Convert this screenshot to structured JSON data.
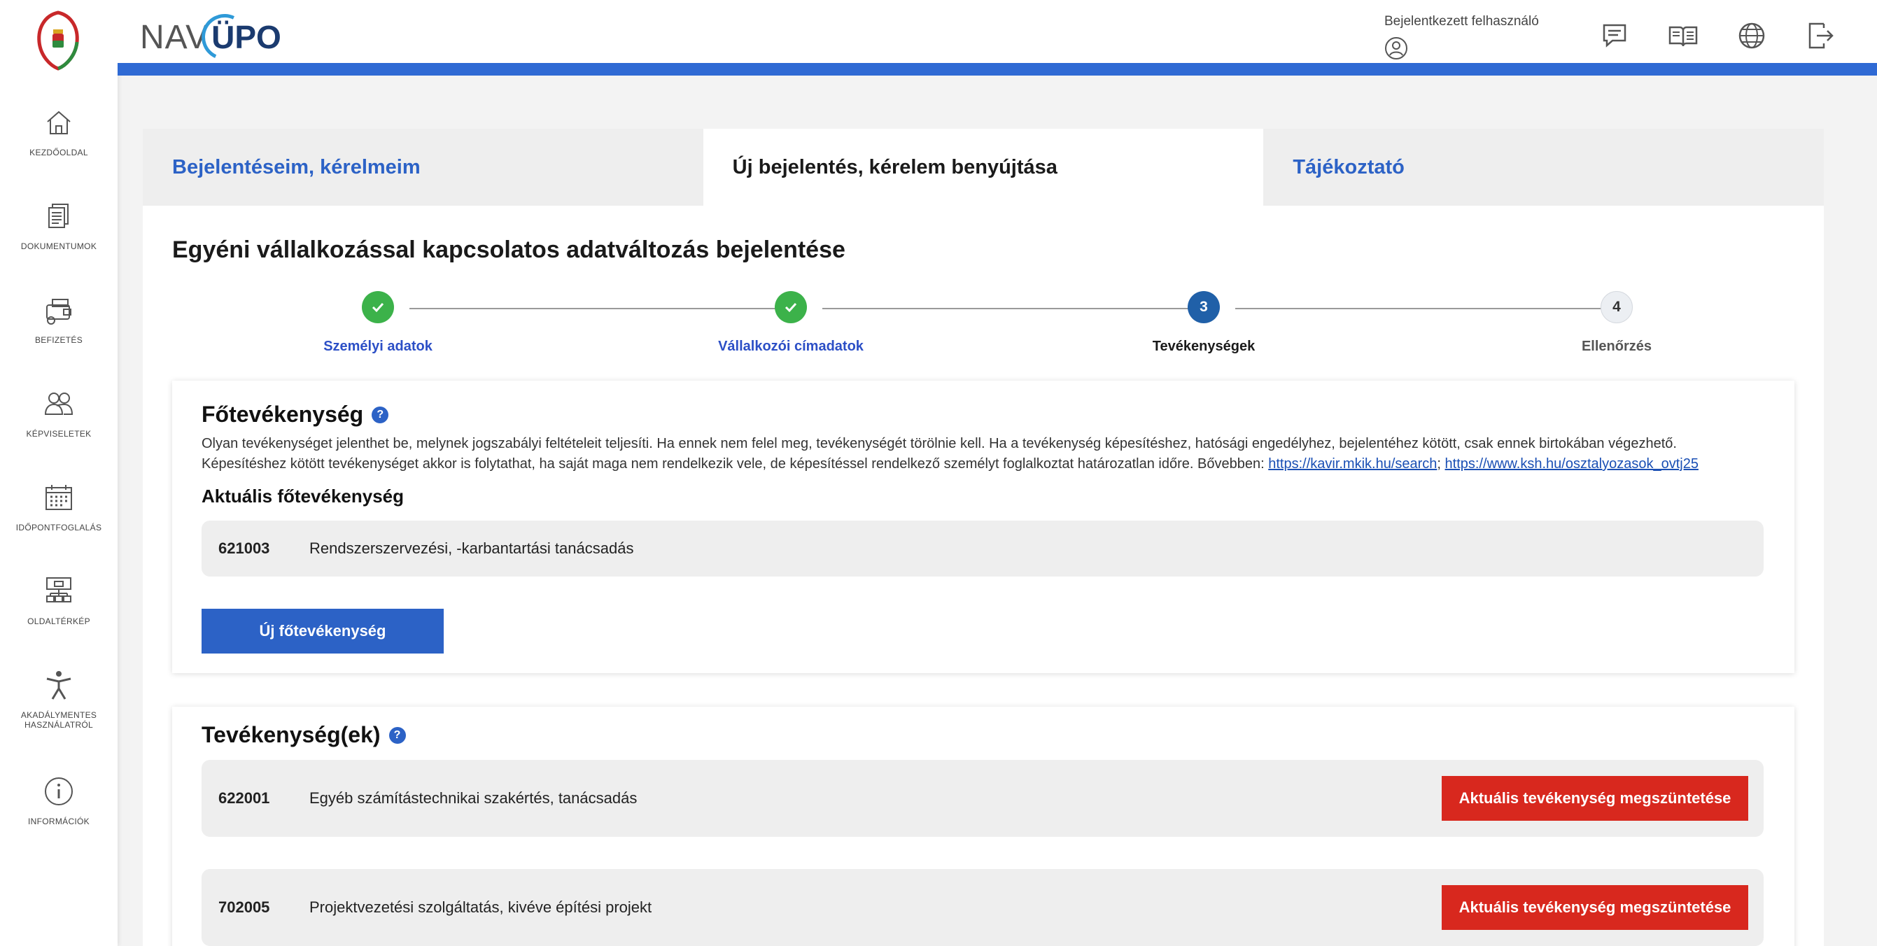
{
  "sidebar": {
    "items": [
      {
        "label": "KEZDŐOLDAL",
        "icon": "home-icon"
      },
      {
        "label": "DOKUMENTUMOK",
        "icon": "documents-icon"
      },
      {
        "label": "BEFIZETÉS",
        "icon": "wallet-icon"
      },
      {
        "label": "KÉPVISELETEK",
        "icon": "people-icon"
      },
      {
        "label": "IDŐPONTFOGLALÁS",
        "icon": "calendar-icon"
      },
      {
        "label": "OLDALTÉRKÉP",
        "icon": "sitemap-icon"
      },
      {
        "label": "AKADÁLYMENTES HASZNÁLATRÓL",
        "icon": "accessibility-icon"
      },
      {
        "label": "INFORMÁCIÓK",
        "icon": "info-icon"
      }
    ]
  },
  "header": {
    "brand_nav": "NAV",
    "brand_upo": "ÜPO",
    "user_label": "Bejelentkezett felhasználó",
    "icons": [
      "chat-icon",
      "book-icon",
      "globe-icon",
      "logout-icon"
    ],
    "accent": "#2f6ad4"
  },
  "tabs": [
    {
      "label": "Bejelentéseim, kérelmeim",
      "active": false
    },
    {
      "label": "Új bejelentés, kérelem benyújtása",
      "active": true
    },
    {
      "label": "Tájékoztató",
      "active": false
    }
  ],
  "page": {
    "title": "Egyéni vállalkozással kapcsolatos adatváltozás bejelentése"
  },
  "stepper": {
    "steps": [
      {
        "number": "1",
        "label": "Személyi adatok",
        "state": "done"
      },
      {
        "number": "2",
        "label": "Vállalkozói címadatok",
        "state": "done"
      },
      {
        "number": "3",
        "label": "Tevékenységek",
        "state": "current"
      },
      {
        "number": "4",
        "label": "Ellenőrzés",
        "state": "todo"
      }
    ]
  },
  "main_activity": {
    "title": "Főtevékenység",
    "help_icon": "?",
    "description": "Olyan tevékenységet jelenthet be, melynek jogszabályi feltételeit teljesíti. Ha ennek nem felel meg, tevékenységét törölnie kell. Ha a tevékenység képesítéshez, hatósági engedélyhez, bejelentéhez kötött, csak ennek birtokában végezhető. Képesítéshez kötött tevékenységet akkor is folytathat, ha saját maga nem rendelkezik vele, de képesítéssel rendelkező személyt foglalkoztat határozatlan időre. Bővebben:",
    "link1": "https://kavir.mkik.hu/search",
    "separator": ";",
    "link2": "https://www.ksh.hu/osztalyozasok_ovtj25",
    "current_label": "Aktuális főtevékenység",
    "current": {
      "code": "621003",
      "name": "Rendszerszervezési, -karbantartási tanácsadás"
    },
    "new_button": "Új főtevékenység"
  },
  "activities": {
    "title": "Tevékenység(ek)",
    "help_icon": "?",
    "items": [
      {
        "code": "622001",
        "name": "Egyéb számítástechnikai szakértés, tanácsadás",
        "button": "Aktuális tevékenység megszüntetése"
      },
      {
        "code": "702005",
        "name": "Projektvezetési szolgáltatás, kivéve építési projekt",
        "button": "Aktuális tevékenység megszüntetése"
      }
    ]
  }
}
